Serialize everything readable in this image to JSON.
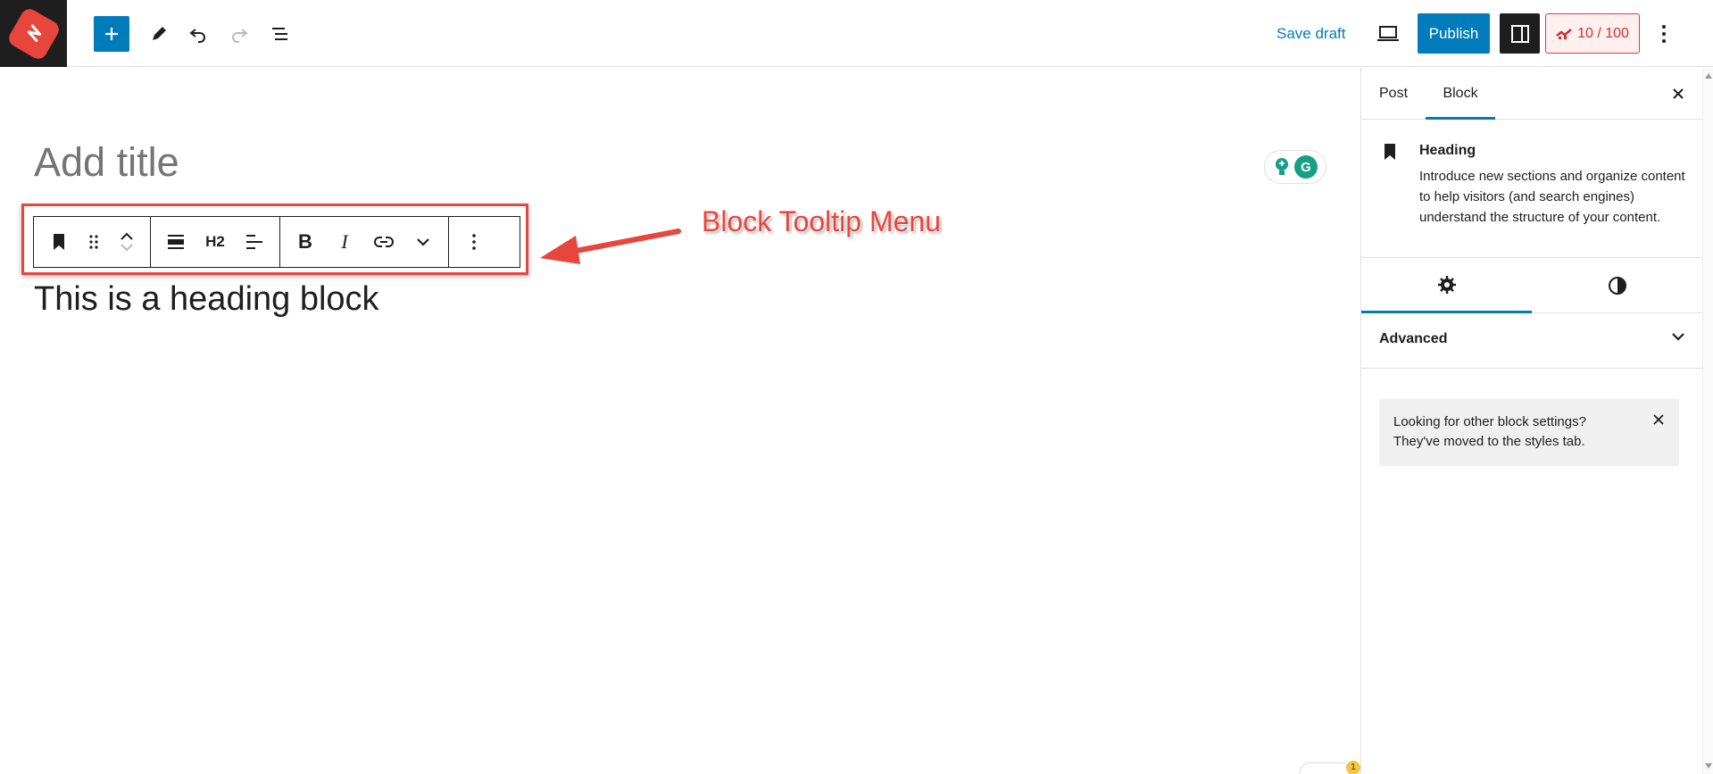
{
  "topbar": {
    "save_draft": "Save draft",
    "publish": "Publish",
    "score": "10 / 100"
  },
  "editor": {
    "title_placeholder": "Add title",
    "heading_text": "This is a heading block",
    "heading_level": "H2",
    "annotation": "Block Tooltip Menu"
  },
  "sidebar": {
    "tabs": [
      "Post",
      "Block"
    ],
    "active_tab": "Block",
    "block_name": "Heading",
    "block_description": "Introduce new sections and organize content to help visitors (and search engines) understand the structure of your content.",
    "advanced_label": "Advanced",
    "notice": "Looking for other block settings? They've moved to the styles tab."
  },
  "grammarly": {
    "badge_count": "1"
  },
  "colors": {
    "accent": "#007cba",
    "annotation_red": "#e8453c",
    "dark": "#1e1e1e"
  },
  "icons": [
    "plus-icon",
    "pencil-icon",
    "undo-icon",
    "redo-icon",
    "list-view-icon",
    "desktop-preview-icon",
    "sidebar-toggle-icon",
    "more-options-icon",
    "close-icon",
    "bookmark-icon",
    "drag-handle-icon",
    "move-up-icon",
    "move-down-icon",
    "align-icon",
    "text-align-icon",
    "link-icon",
    "chevron-down-icon",
    "gear-icon",
    "contrast-icon"
  ]
}
